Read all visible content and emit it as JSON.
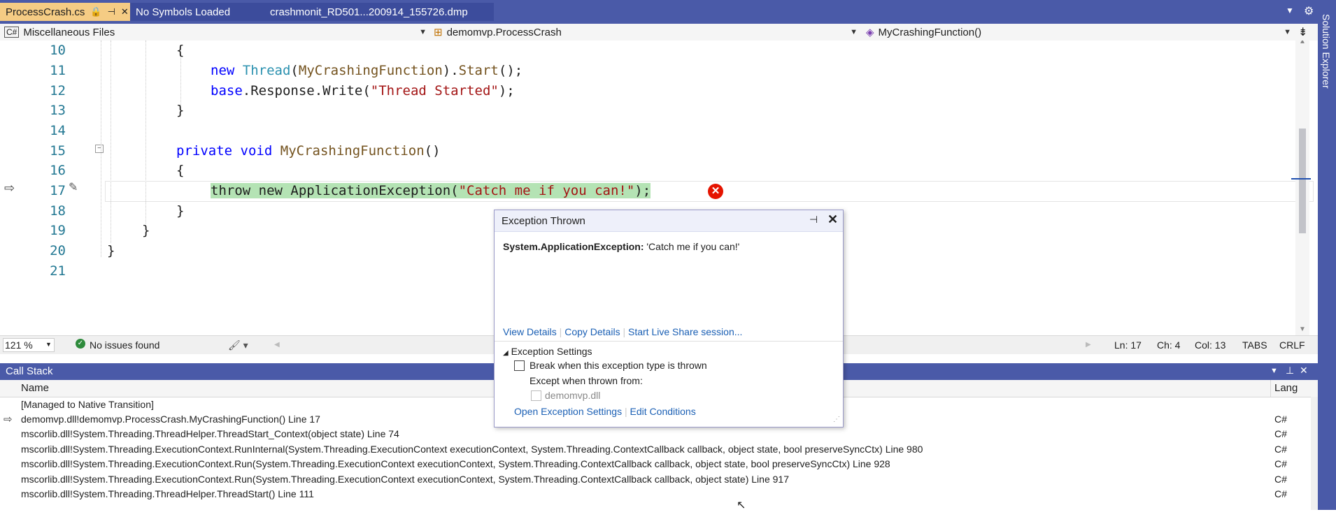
{
  "tabs": [
    {
      "label": "ProcessCrash.cs",
      "active": true,
      "icons": "🔒 ⊣ ✕"
    },
    {
      "label": "No Symbols Loaded",
      "active": false
    },
    {
      "label": "crashmonit_RD501...200914_155726.dmp",
      "active": false
    }
  ],
  "navbar": {
    "project": "Miscellaneous Files",
    "class": "demomvp.ProcessCrash",
    "member": "MyCrashingFunction()"
  },
  "sidebar": {
    "label": "Solution Explorer"
  },
  "code_lines": [
    {
      "num": "10"
    },
    {
      "num": "11"
    },
    {
      "num": "12"
    },
    {
      "num": "13"
    },
    {
      "num": "14"
    },
    {
      "num": "15"
    },
    {
      "num": "16"
    },
    {
      "num": "17"
    },
    {
      "num": "18"
    },
    {
      "num": "19"
    },
    {
      "num": "20"
    },
    {
      "num": "21"
    }
  ],
  "code": {
    "l10": "{",
    "l11_kw": "new",
    "l11_ty": "Thread",
    "l11_fn": "MyCrashingFunction",
    "l11_rest_a": "(",
    "l11_rest_b": ").",
    "l11_start": "Start",
    "l11_rest_c": "();",
    "l12_kw": "base",
    "l12_rest_a": ".Response.Write(",
    "l12_str": "\"Thread Started\"",
    "l12_rest_b": ");",
    "l13": "}",
    "l15_kw1": "private",
    "l15_kw2": "void",
    "l15_fn": "MyCrashingFunction",
    "l15_rest": "()",
    "l16": "{",
    "l17_a": "throw new ApplicationException(",
    "l17_str": "\"Catch me if you can!\"",
    "l17_b": ");",
    "l18": "}",
    "l19": "}",
    "l20": "}"
  },
  "status": {
    "zoom": "121 %",
    "issues": "No issues found",
    "ln": "Ln: 17",
    "ch": "Ch: 4",
    "col": "Col: 13",
    "tabs": "TABS",
    "eol": "CRLF"
  },
  "popup": {
    "title": "Exception Thrown",
    "exc_type": "System.ApplicationException:",
    "exc_msg": "'Catch me if you can!'",
    "view_details": "View Details",
    "copy_details": "Copy Details",
    "live_share": "Start Live Share session...",
    "settings_header": "Exception Settings",
    "break_when": "Break when this exception type is thrown",
    "except_when": "Except when thrown from:",
    "module": "demomvp.dll",
    "open_settings": "Open Exception Settings",
    "edit_conditions": "Edit Conditions"
  },
  "callstack": {
    "title": "Call Stack",
    "col_name": "Name",
    "col_lang": "Lang",
    "rows": [
      {
        "name": "[Managed to Native Transition]",
        "lang": ""
      },
      {
        "name": "demomvp.dll!demomvp.ProcessCrash.MyCrashingFunction() Line 17",
        "lang": "C#"
      },
      {
        "name": "mscorlib.dll!System.Threading.ThreadHelper.ThreadStart_Context(object state) Line 74",
        "lang": "C#"
      },
      {
        "name": "mscorlib.dll!System.Threading.ExecutionContext.RunInternal(System.Threading.ExecutionContext executionContext, System.Threading.ContextCallback callback, object state, bool preserveSyncCtx) Line 980",
        "lang": "C#"
      },
      {
        "name": "mscorlib.dll!System.Threading.ExecutionContext.Run(System.Threading.ExecutionContext executionContext, System.Threading.ContextCallback callback, object state, bool preserveSyncCtx) Line 928",
        "lang": "C#"
      },
      {
        "name": "mscorlib.dll!System.Threading.ExecutionContext.Run(System.Threading.ExecutionContext executionContext, System.Threading.ContextCallback callback, object state) Line 917",
        "lang": "C#"
      },
      {
        "name": "mscorlib.dll!System.Threading.ThreadHelper.ThreadStart() Line 111",
        "lang": "C#"
      }
    ]
  },
  "colors": {
    "accent": "#4a5aa8",
    "active_tab": "#f5cc84",
    "highlight": "#b4e3b4",
    "error": "#e51400"
  }
}
